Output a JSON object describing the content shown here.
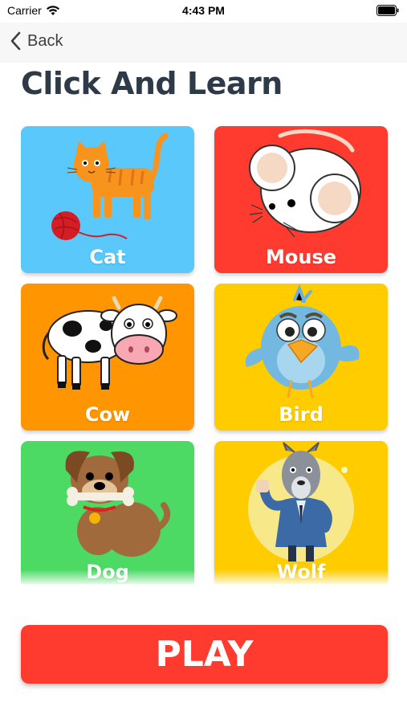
{
  "status_bar": {
    "carrier": "Carrier",
    "time": "4:43 PM",
    "wifi_icon": "wifi-icon",
    "battery_icon": "battery-icon"
  },
  "nav": {
    "back_label": "Back",
    "back_icon": "chevron-left-icon"
  },
  "title": "Click And Learn",
  "animals": [
    {
      "label": "Cat",
      "color": "#5ac8fa",
      "icon": "cat-icon"
    },
    {
      "label": "Mouse",
      "color": "#ff3b30",
      "icon": "mouse-icon"
    },
    {
      "label": "Cow",
      "color": "#ff9500",
      "icon": "cow-icon"
    },
    {
      "label": "Bird",
      "color": "#ffcc00",
      "icon": "bird-icon"
    },
    {
      "label": "Dog",
      "color": "#4cd964",
      "icon": "dog-icon"
    },
    {
      "label": "Wolf",
      "color": "#ffcc00",
      "icon": "wolf-icon"
    }
  ],
  "play": {
    "label": "PLAY",
    "color": "#ff3b30"
  }
}
